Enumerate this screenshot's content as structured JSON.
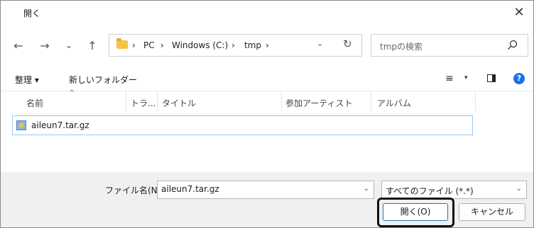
{
  "window": {
    "title": "開く",
    "close_glyph": "✕"
  },
  "navigation": {
    "back_glyph": "←",
    "forward_glyph": "→",
    "recent_glyph": "⌄",
    "up_glyph": "↑",
    "breadcrumbs": [
      "PC",
      "Windows (C:)",
      "tmp"
    ],
    "separator": "›",
    "dropdown_glyph": "⌄",
    "refresh_glyph": "↻"
  },
  "search": {
    "placeholder": "tmpの検索"
  },
  "toolbar": {
    "organize_label": "整理 ▾",
    "new_folder_label": "新しいフォルダー",
    "view_glyph": "≡",
    "view_dropdown_glyph": "▾",
    "help_glyph": "?"
  },
  "columns": {
    "name": "名前",
    "track": "トラ...",
    "title": "タイトル",
    "artist": "参加アーティスト",
    "album": "アルバム",
    "sort_glyph": "^"
  },
  "files": [
    {
      "name": "aileun7.tar.gz"
    }
  ],
  "footer": {
    "filename_label": "ファイル名(N):",
    "filename_value": "aileun7.tar.gz",
    "filter_value": "すべてのファイル (*.*)",
    "dropdown_glyph": "⌄",
    "open_label": "開く(O)",
    "cancel_label": "キャンセル"
  },
  "colors": {
    "accent": "#1a73e8",
    "folder": "#f4c542",
    "selection_border": "#9cc6ee"
  }
}
